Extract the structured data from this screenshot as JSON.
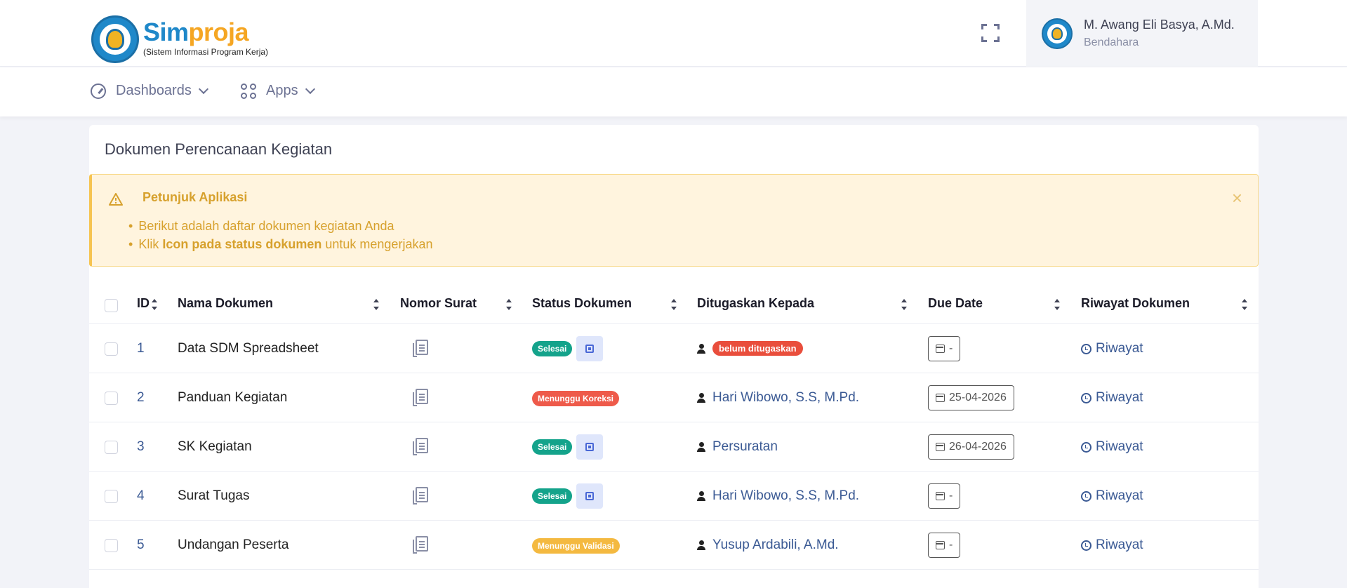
{
  "header": {
    "brand_part1": "Sim",
    "brand_part2": "proja",
    "brand_subtitle": "(Sistem Informasi Program Kerja)",
    "fullscreen_icon": "fullscreen-icon",
    "user": {
      "name": "M. Awang Eli Basya, A.Md.",
      "role": "Bendahara"
    }
  },
  "nav": {
    "items": [
      {
        "label": "Dashboards",
        "icon": "gauge-icon"
      },
      {
        "label": "Apps",
        "icon": "apps-grid-icon"
      }
    ]
  },
  "card": {
    "title": "Dokumen Perencanaan Kegiatan",
    "alert": {
      "title": "Petunjuk Aplikasi",
      "line1": "Berikut adalah daftar dokumen kegiatan Anda",
      "line2_pre": "Klik ",
      "line2_bold": "Icon pada status dokumen",
      "line2_post": " untuk mengerjakan",
      "close": "×"
    }
  },
  "table": {
    "columns": [
      "ID",
      "Nama Dokumen",
      "Nomor Surat",
      "Status Dokumen",
      "Ditugaskan Kepada",
      "Due Date",
      "Riwayat Dokumen"
    ],
    "rows": [
      {
        "id": "1",
        "name": "Data SDM Spreadsheet",
        "status": "Selesai",
        "assignee": "belum ditugaskan",
        "due": "-",
        "history": "Riwayat"
      },
      {
        "id": "2",
        "name": "Panduan Kegiatan",
        "status": "Menunggu Koreksi",
        "assignee": "Hari Wibowo, S.S, M.Pd.",
        "due": "25-04-2026",
        "history": "Riwayat"
      },
      {
        "id": "3",
        "name": "SK Kegiatan",
        "status": "Selesai",
        "assignee": "Persuratan",
        "due": "26-04-2026",
        "history": "Riwayat"
      },
      {
        "id": "4",
        "name": "Surat Tugas",
        "status": "Selesai",
        "assignee": "Hari Wibowo, S.S, M.Pd.",
        "due": "-",
        "history": "Riwayat"
      },
      {
        "id": "5",
        "name": "Undangan Peserta",
        "status": "Menunggu Validasi",
        "assignee": "Yusup Ardabili, A.Md.",
        "due": "-",
        "history": "Riwayat"
      }
    ]
  },
  "colors": {
    "brand_blue": "#1f88c9",
    "brand_orange": "#f5a623",
    "status_done": "#14a38b",
    "status_correction": "#ee5a4a",
    "status_validation": "#f4b940",
    "link": "#3b5a94"
  }
}
